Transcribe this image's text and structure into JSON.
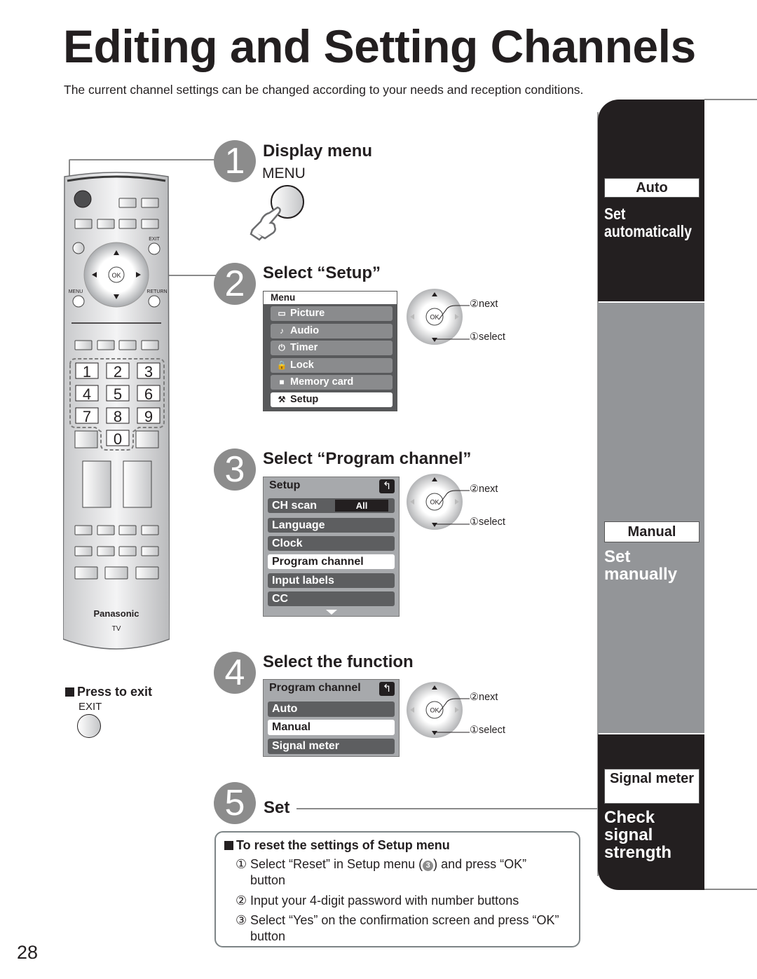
{
  "page": {
    "title": "Editing and Setting Channels",
    "subtitle": "The current channel settings can be changed according to your needs and reception conditions.",
    "page_number": "28"
  },
  "remote": {
    "brand": "Panasonic",
    "model": "TV",
    "labels": {
      "exit": "EXIT",
      "menu": "MENU",
      "return": "RETURN",
      "ok": "OK"
    },
    "number_keys": [
      "1",
      "2",
      "3",
      "4",
      "5",
      "6",
      "7",
      "8",
      "9",
      "0"
    ]
  },
  "exit_hint": {
    "title": "Press to exit",
    "button_label": "EXIT"
  },
  "steps": [
    {
      "number": "1",
      "title": "Display menu",
      "button_label": "MENU"
    },
    {
      "number": "2",
      "title": "Select “Setup”"
    },
    {
      "number": "3",
      "title": "Select “Program channel”"
    },
    {
      "number": "4",
      "title": "Select the function"
    },
    {
      "number": "5",
      "title": "Set"
    }
  ],
  "menu_main": {
    "header": "Menu",
    "items": [
      {
        "label": "Picture",
        "icon": "picture-icon",
        "glyph": "▭",
        "selected": false
      },
      {
        "label": "Audio",
        "icon": "music-note-icon",
        "glyph": "♪",
        "selected": false
      },
      {
        "label": "Timer",
        "icon": "power-icon",
        "glyph": "⏻",
        "selected": false
      },
      {
        "label": "Lock",
        "icon": "lock-icon",
        "glyph": "🔒",
        "selected": false
      },
      {
        "label": "Memory card",
        "icon": "memory-card-icon",
        "glyph": "■",
        "selected": false
      },
      {
        "label": "Setup",
        "icon": "setup-tool-icon",
        "glyph": "⚒",
        "selected": true
      }
    ]
  },
  "menu_setup": {
    "header": "Setup",
    "items": [
      {
        "label": "CH scan",
        "value": "All",
        "selected": false
      },
      {
        "label": "Language",
        "selected": false
      },
      {
        "label": "Clock",
        "selected": false
      },
      {
        "label": "Program channel",
        "selected": true
      },
      {
        "label": "Input labels",
        "selected": false
      },
      {
        "label": "CC",
        "selected": false
      }
    ]
  },
  "menu_program": {
    "header": "Program channel",
    "items": [
      {
        "label": "Auto",
        "selected": false
      },
      {
        "label": "Manual",
        "selected": true
      },
      {
        "label": "Signal meter",
        "selected": false
      }
    ]
  },
  "dpad_hint": {
    "ok": "OK",
    "next": "②next",
    "select": "①select"
  },
  "side_tabs": [
    {
      "tag": "Auto",
      "description": "Set automatically"
    },
    {
      "tag": "Manual",
      "description": "Set manually"
    },
    {
      "tag": "Signal meter",
      "description": "Check signal strength"
    }
  ],
  "reset_box": {
    "title": "To reset the settings of Setup menu",
    "items": [
      {
        "num": "①",
        "text_before": "Select “Reset” in Setup menu (",
        "ref": "3",
        "text_after": ") and press “OK” button"
      },
      {
        "num": "②",
        "text": "Input your 4-digit password with number buttons"
      },
      {
        "num": "③",
        "text": "Select “Yes” on the confirmation screen and press “OK” button"
      }
    ]
  },
  "colors": {
    "text": "#231f20",
    "step_circle": "#8c8c8c",
    "dark_tab": "#231f20",
    "mid_tab": "#939598",
    "osd_bg": "#a7a9ac",
    "osd_row": "#5d5e60"
  }
}
